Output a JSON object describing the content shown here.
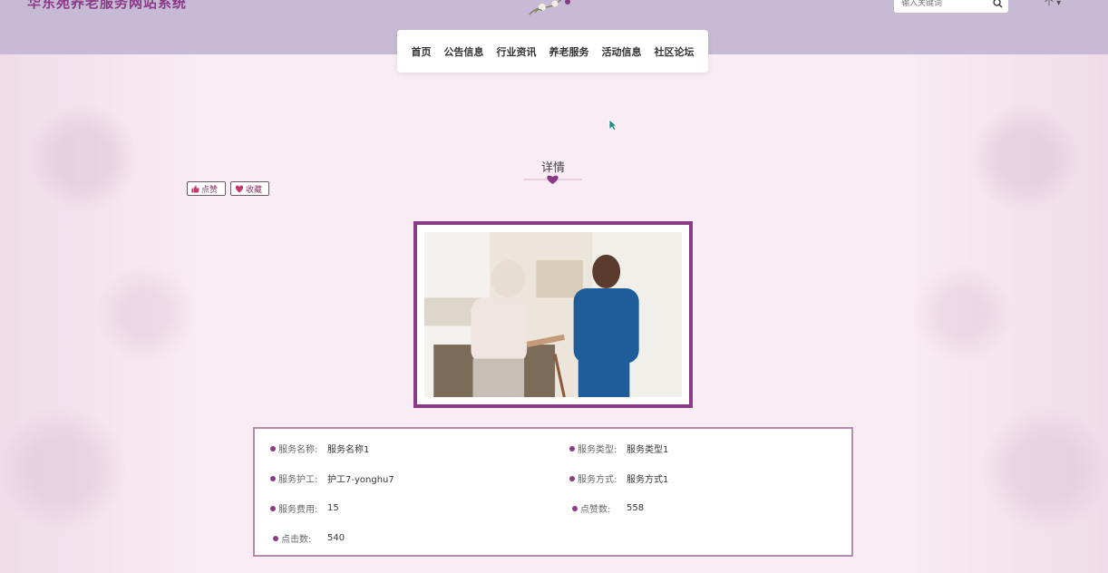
{
  "header": {
    "site_title": "华东苑养老服务网站系统",
    "search_placeholder": "输入关键词",
    "user_menu": "个 ▾"
  },
  "nav": {
    "items": [
      "首页",
      "公告信息",
      "行业资讯",
      "养老服务",
      "活动信息",
      "社区论坛"
    ]
  },
  "page": {
    "section_title": "详情",
    "like_label": "点赞",
    "favorite_label": "收藏"
  },
  "details": {
    "service_name_label": "服务名称:",
    "service_name": "服务名称1",
    "service_type_label": "服务类型:",
    "service_type": "服务类型1",
    "nurse_label": "服务护工:",
    "nurse": "护工7-yonghu7",
    "service_method_label": "服务方式:",
    "service_method": "服务方式1",
    "fee_label": "服务费用:",
    "fee": "15",
    "likes_label": "点赞数:",
    "likes": "558",
    "clicks_label": "点击数:",
    "clicks": "540"
  },
  "colors": {
    "accent": "#8b3a86",
    "header_bg": "#c6bad5",
    "page_bg": "#f9ecf4"
  },
  "icons": [
    "search-icon",
    "thumbs-up-icon",
    "heart-icon",
    "cursor-icon",
    "heart-divider-icon",
    "floral-logo-icon"
  ]
}
